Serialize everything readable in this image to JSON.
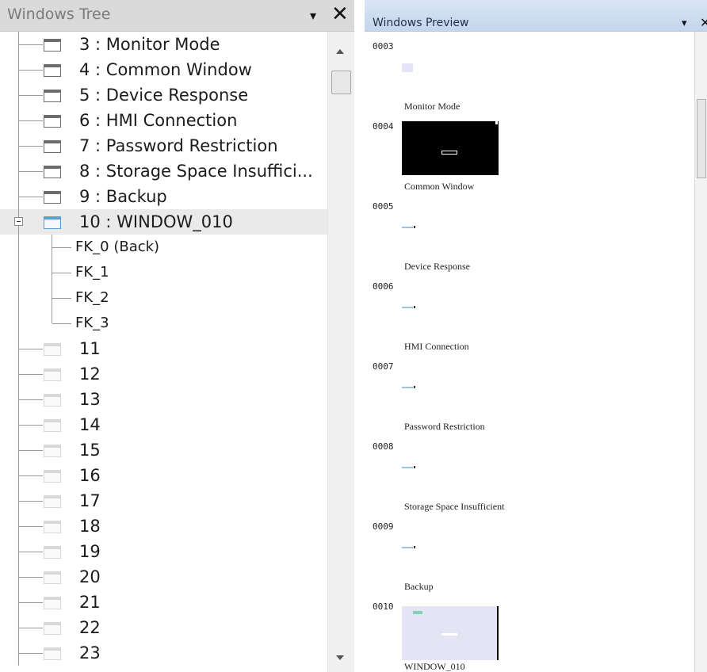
{
  "tree_panel": {
    "title": "Windows Tree",
    "dropdown_glyph": "▾",
    "close_glyph": "✕",
    "items": [
      {
        "label": "3 : Monitor Mode",
        "kind": "window"
      },
      {
        "label": "4 : Common Window",
        "kind": "window"
      },
      {
        "label": "5 : Device Response",
        "kind": "window"
      },
      {
        "label": "6 : HMI Connection",
        "kind": "window"
      },
      {
        "label": "7 : Password Restriction",
        "kind": "window"
      },
      {
        "label": "8 : Storage Space Insuffici...",
        "kind": "window"
      },
      {
        "label": "9 : Backup",
        "kind": "window"
      },
      {
        "label": "10 : WINDOW_010",
        "kind": "window-active",
        "expanded": true,
        "selected": true
      },
      {
        "label": "FK_0 (Back)",
        "kind": "child"
      },
      {
        "label": "FK_1",
        "kind": "child"
      },
      {
        "label": "FK_2",
        "kind": "child"
      },
      {
        "label": "FK_3",
        "kind": "child-last"
      },
      {
        "label": "11",
        "kind": "empty"
      },
      {
        "label": "12",
        "kind": "empty"
      },
      {
        "label": "13",
        "kind": "empty"
      },
      {
        "label": "14",
        "kind": "empty"
      },
      {
        "label": "15",
        "kind": "empty"
      },
      {
        "label": "16",
        "kind": "empty"
      },
      {
        "label": "17",
        "kind": "empty"
      },
      {
        "label": "18",
        "kind": "empty"
      },
      {
        "label": "19",
        "kind": "empty"
      },
      {
        "label": "20",
        "kind": "empty"
      },
      {
        "label": "21",
        "kind": "empty"
      },
      {
        "label": "22",
        "kind": "empty"
      },
      {
        "label": "23",
        "kind": "empty"
      }
    ]
  },
  "preview_panel": {
    "title": "Windows Preview",
    "dropdown_glyph": "▾",
    "close_glyph": "✕",
    "entries": [
      {
        "id": "0003",
        "name": "Monitor Mode",
        "thumb": "tiny-lavender"
      },
      {
        "id": "0004",
        "name": "Common Window",
        "thumb": "black"
      },
      {
        "id": "0005",
        "name": "Device Response",
        "thumb": "tiny-bar"
      },
      {
        "id": "0006",
        "name": "HMI Connection",
        "thumb": "tiny-bar"
      },
      {
        "id": "0007",
        "name": "Password Restriction",
        "thumb": "tiny-bar"
      },
      {
        "id": "0008",
        "name": "Storage Space Insufficient",
        "thumb": "tiny-bar"
      },
      {
        "id": "0009",
        "name": "Backup",
        "thumb": "tiny-bar"
      },
      {
        "id": "0010",
        "name": "WINDOW_010",
        "thumb": "lavender-large"
      }
    ]
  },
  "colors": {
    "tree_header_bg": "#dadada",
    "preview_header_bg": "#c9daee",
    "selected_row_bg": "#eaeaea",
    "active_window_icon": "#5c9fd6",
    "thumb_lavender": "#e4e4f4",
    "thumb_black": "#000000"
  }
}
